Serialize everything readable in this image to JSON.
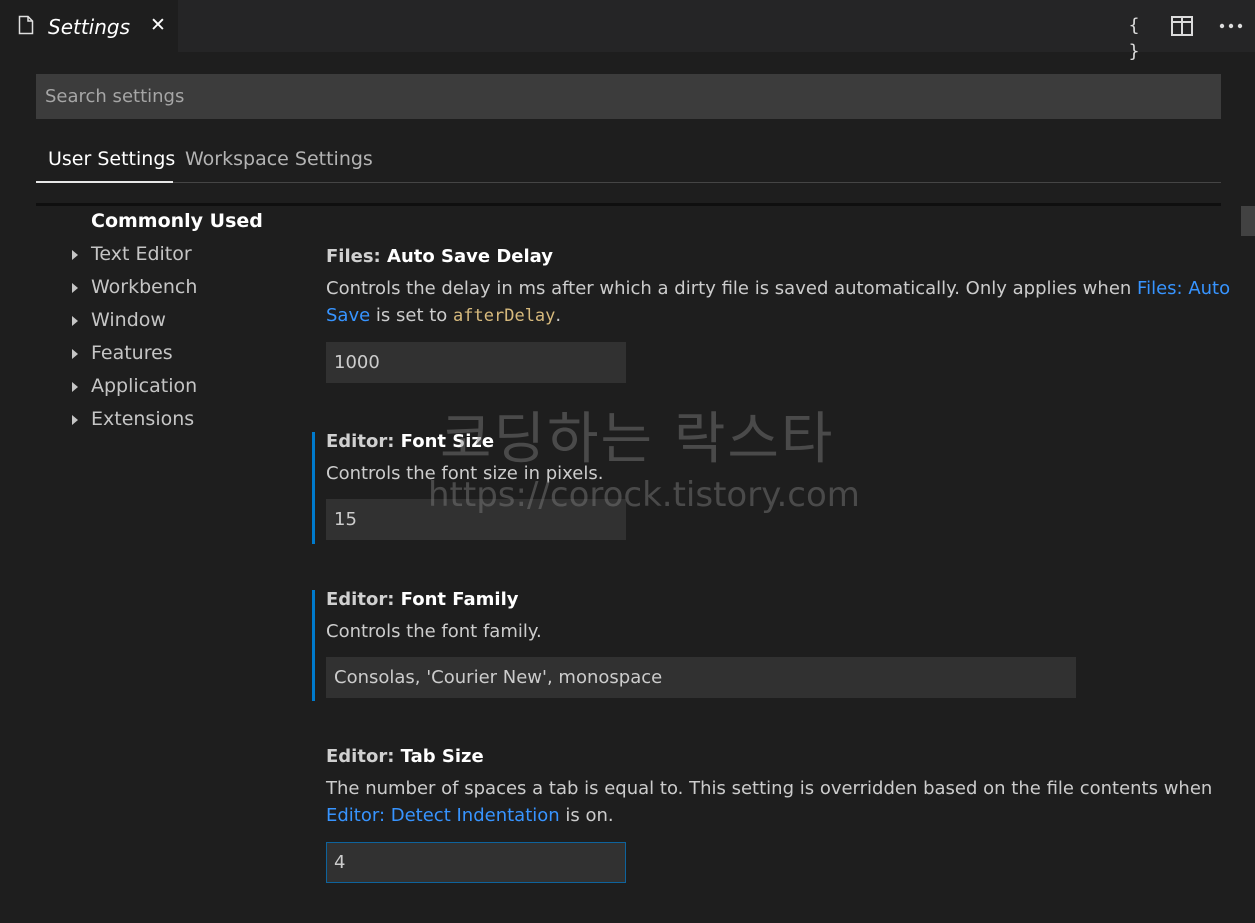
{
  "tab": {
    "title": "Settings",
    "close_symbol": "✕"
  },
  "actions": {
    "json_symbol": "{ }"
  },
  "search": {
    "placeholder": "Search settings"
  },
  "settings_tabs": {
    "user": "User Settings",
    "workspace": "Workspace Settings"
  },
  "toc": {
    "heading": "Commonly Used",
    "items": [
      "Text Editor",
      "Workbench",
      "Window",
      "Features",
      "Application",
      "Extensions"
    ]
  },
  "settings": [
    {
      "category": "Files: ",
      "name": "Auto Save Delay",
      "desc_before": "Controls the delay in ms after which a dirty file is saved automatically. Only applies when ",
      "desc_link": "Files: Auto Save",
      "desc_middle": " is set to ",
      "desc_code": "afterDelay",
      "desc_after": ".",
      "value": "1000"
    },
    {
      "category": "Editor: ",
      "name": "Font Size",
      "desc": "Controls the font size in pixels.",
      "value": "15"
    },
    {
      "category": "Editor: ",
      "name": "Font Family",
      "desc": "Controls the font family.",
      "value": "Consolas, 'Courier New', monospace"
    },
    {
      "category": "Editor: ",
      "name": "Tab Size",
      "desc_before": "The number of spaces a tab is equal to. This setting is overridden based on the file contents when ",
      "desc_link": "Editor: Detect Indentation",
      "desc_after": " is on.",
      "value": "4"
    }
  ],
  "watermark": {
    "line1": "코딩하는 락스타",
    "line2": "https://corock.tistory.com"
  },
  "colors": {
    "accent": "#007acc",
    "link": "#3794ff",
    "code": "#d7ba7d",
    "background": "#1e1e1e"
  },
  "icons": {
    "tab_icon": "file-icon",
    "json": "open-settings-json-icon",
    "split": "split-editor-icon",
    "more": "more-actions-icon",
    "toc_arrow": "chevron-right-icon"
  }
}
